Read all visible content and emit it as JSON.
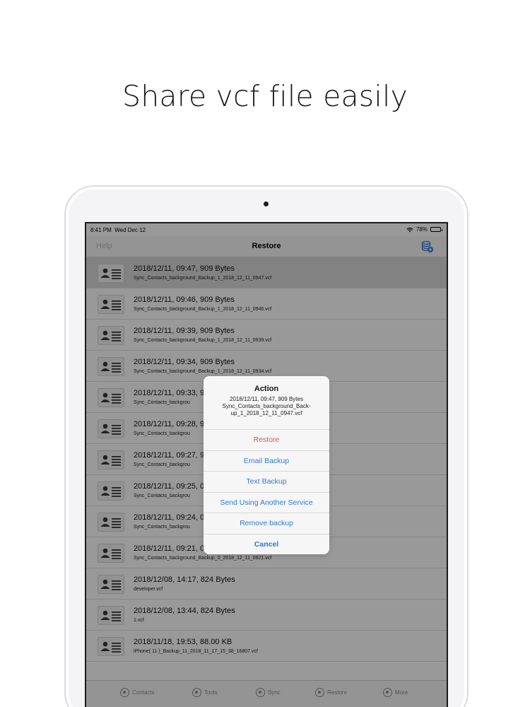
{
  "headline": "Share vcf file easily",
  "status_bar": {
    "time": "8:41 PM",
    "date": "Wed Dec 12",
    "battery": "78%",
    "battery_level": 0.78
  },
  "nav": {
    "left": "Help",
    "title": "Restore",
    "right_icon": "database-add-icon"
  },
  "backups": [
    {
      "line1": "2018/12/11, 09:47, 909 Bytes",
      "line2": "Sync_Contacts_background_Backup_1_2018_12_11_0947.vcf",
      "selected": true
    },
    {
      "line1": "2018/12/11, 09:46, 909 Bytes",
      "line2": "Sync_Contacts_background_Backup_1_2018_12_11_0946.vcf"
    },
    {
      "line1": "2018/12/11, 09:39, 909 Bytes",
      "line2": "Sync_Contacts_background_Backup_1_2018_12_11_0939.vcf"
    },
    {
      "line1": "2018/12/11, 09:34, 909 Bytes",
      "line2": "Sync_Contacts_background_Backup_1_2018_12_11_0934.vcf"
    },
    {
      "line1": "2018/12/11, 09:33, 9",
      "line2": "Sync_Contacts_backgrou"
    },
    {
      "line1": "2018/12/11, 09:28, 9",
      "line2": "Sync_Contacts_backgrou"
    },
    {
      "line1": "2018/12/11, 09:27, 9",
      "line2": "Sync_Contacts_backgrou"
    },
    {
      "line1": "2018/12/11, 09:25, 0",
      "line2": "Sync_Contacts_backgrou"
    },
    {
      "line1": "2018/12/11, 09:24, 0",
      "line2": "Sync_Contacts_backgrou"
    },
    {
      "line1": "2018/12/11, 09:21, 0",
      "line2": "Sync_Contacts_background_Backup_0_2018_12_11_0921.vcf"
    },
    {
      "line1": "2018/12/08, 14:17, 824 Bytes",
      "line2": "developer.vcf"
    },
    {
      "line1": "2018/12/08, 13:44, 824 Bytes",
      "line2": "1.vcf"
    },
    {
      "line1": "2018/11/18, 19:53, 88.00 KB",
      "line2": "iPhone( 11 )_Backup_11_2018_11_17_15_38_16807.vcf"
    }
  ],
  "tabs": [
    {
      "label": "Contacts",
      "icon": "contacts-icon"
    },
    {
      "label": "Tools",
      "icon": "tools-icon"
    },
    {
      "label": "Sync",
      "icon": "sync-icon"
    },
    {
      "label": "Restore",
      "icon": "restore-icon"
    },
    {
      "label": "More",
      "icon": "more-icon"
    }
  ],
  "action_sheet": {
    "title": "Action",
    "message": "2018/12/11, 09:47, 909 Bytes Sync_Contacts_background_Back-up_1_2018_12_11_0947.vcf",
    "actions": [
      {
        "label": "Restore",
        "style": "destructive"
      },
      {
        "label": "Email Backup",
        "style": "default"
      },
      {
        "label": "Text Backup",
        "style": "default"
      },
      {
        "label": "Send Using Another Service",
        "style": "default"
      },
      {
        "label": "Remove backup",
        "style": "default"
      },
      {
        "label": "Cancel",
        "style": "cancel"
      }
    ]
  },
  "colors": {
    "accent": "#2b7bd4",
    "destructive": "#e45050",
    "dim_overlay": "rgba(0,0,0,0.40)"
  }
}
